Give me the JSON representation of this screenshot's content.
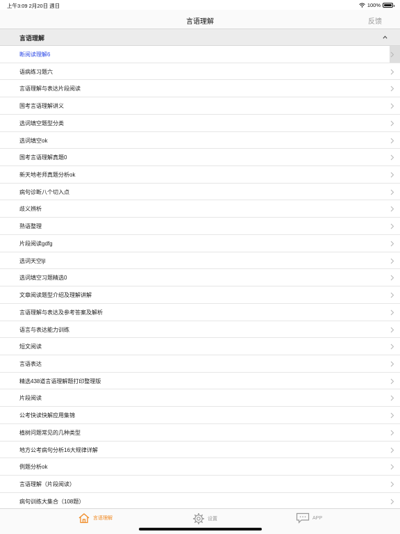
{
  "status_bar": {
    "time_date": "上午3:09   2月20日 週日",
    "battery": "100%"
  },
  "nav": {
    "title": "言语理解",
    "feedback": "反馈"
  },
  "section": {
    "label": "言语理解",
    "chevron_icon": "chevron-up-icon"
  },
  "list": {
    "items": [
      {
        "label": "断阅读理解6"
      },
      {
        "label": "语病练习题六"
      },
      {
        "label": "言语理解与表达片段阅读"
      },
      {
        "label": "国考言语理解讲义"
      },
      {
        "label": "选词填空题型分类"
      },
      {
        "label": "选词填空ok"
      },
      {
        "label": "国考言语理解真题0"
      },
      {
        "label": "新天地老师真题分析ok"
      },
      {
        "label": "病句诊断八个切入点"
      },
      {
        "label": "歧义辨析"
      },
      {
        "label": "熟语整理"
      },
      {
        "label": "片段阅读gdfg"
      },
      {
        "label": "选词天空ljl"
      },
      {
        "label": "选词填空习题精选0"
      },
      {
        "label": "文章阅读题型介绍及理解讲解"
      },
      {
        "label": "言语理解与表达及参考答案及解析"
      },
      {
        "label": "语言与表达能力训练"
      },
      {
        "label": "短文阅读"
      },
      {
        "label": "言语表达"
      },
      {
        "label": "精选438道言语理解题打印整理版"
      },
      {
        "label": "片段阅读"
      },
      {
        "label": "公考快读快解应用集锦"
      },
      {
        "label": "植树问题常见的几种类型"
      },
      {
        "label": "地方公考病句分析16大规律详解"
      },
      {
        "label": "例题分析ok"
      },
      {
        "label": "言语理解（片段阅读）"
      },
      {
        "label": "病句训练大集合（108题）"
      }
    ]
  },
  "tabs": [
    {
      "label": "言语理解",
      "icon": "home-icon"
    },
    {
      "label": "设置",
      "icon": "gear-icon"
    },
    {
      "label": "APP",
      "icon": "chat-bubble-icon"
    }
  ],
  "colors": {
    "accent": "#f08a24",
    "active_link": "#2b48e6"
  }
}
